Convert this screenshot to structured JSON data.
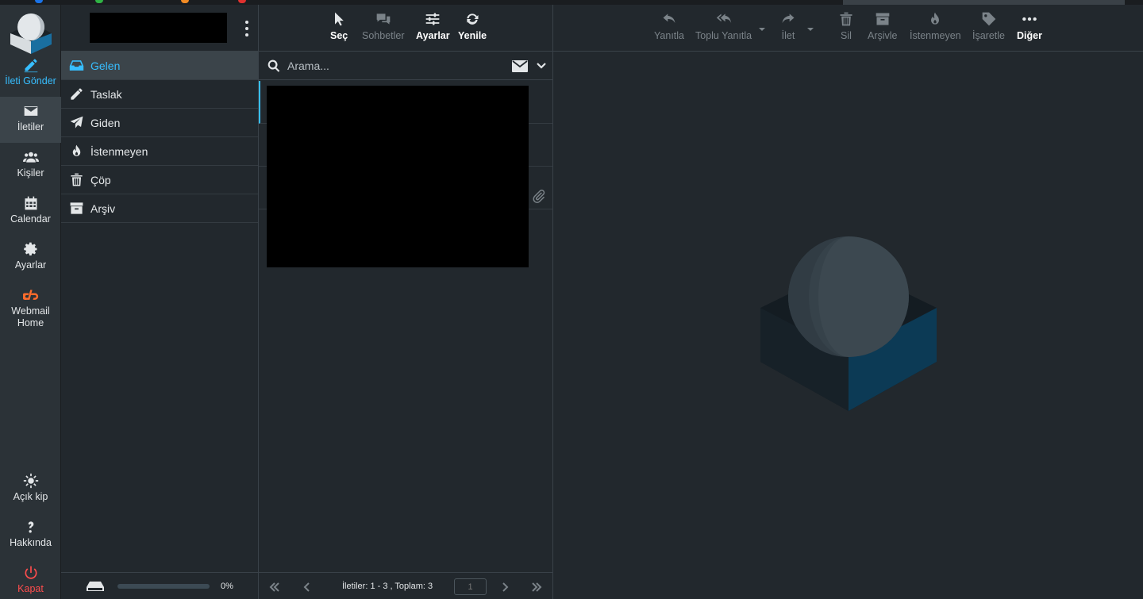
{
  "nav": {
    "compose": "İleti Gönder",
    "messages": "İletiler",
    "contacts": "Kişiler",
    "calendar": "Calendar",
    "settings": "Ayarlar",
    "webmail_home": "Webmail Home",
    "theme_toggle": "Açık kip",
    "about": "Hakkında",
    "logout": "Kapat"
  },
  "folders": [
    {
      "label": "Gelen",
      "icon": "inbox-icon",
      "selected": true
    },
    {
      "label": "Taslak",
      "icon": "pencil-icon"
    },
    {
      "label": "Giden",
      "icon": "paper-plane-icon"
    },
    {
      "label": "İstenmeyen",
      "icon": "fire-icon"
    },
    {
      "label": "Çöp",
      "icon": "trash-icon"
    },
    {
      "label": "Arşiv",
      "icon": "archive-icon"
    }
  ],
  "quota": {
    "text": "0%",
    "fraction": 0.0
  },
  "list_toolbar": {
    "select": "Seç",
    "threads": "Sohbetler",
    "options": "Ayarlar",
    "refresh": "Yenile"
  },
  "search": {
    "placeholder": "Arama..."
  },
  "list_footer": {
    "count": "İletiler: 1 - 3 , Toplam: 3",
    "page": "1"
  },
  "reader_toolbar": {
    "reply": "Yanıtla",
    "reply_all": "Toplu Yanıtla",
    "forward": "İlet",
    "delete": "Sil",
    "archive": "Arşivle",
    "junk": "İstenmeyen",
    "mark": "İşaretle",
    "more": "Diğer"
  },
  "colors": {
    "accent": "#37beff",
    "logout": "#ff4d4d",
    "cpanel": "#ff6c2c",
    "background": "#22282d",
    "sidebar": "#2b3237"
  }
}
